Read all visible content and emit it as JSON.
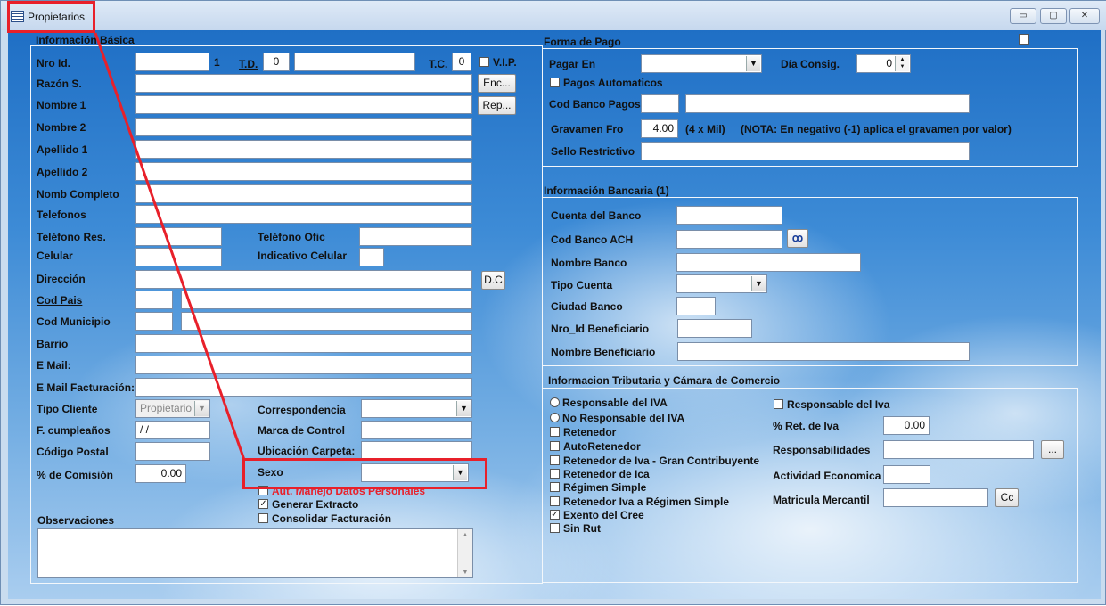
{
  "window": {
    "title": "Propietarios",
    "minimize": "▭",
    "maximize": "▢",
    "close": "✕"
  },
  "basic": {
    "section": "Información Básica",
    "nro_id_label": "Nro Id.",
    "nro_id_value": "",
    "id_suffix": "1",
    "td_label": "T.D.",
    "td_value": "0",
    "tc_label": "T.C.",
    "tc_value": "0",
    "vip_label": "V.I.P.",
    "razon_label": "Razón S.",
    "nombre1_label": "Nombre 1",
    "nombre2_label": "Nombre 2",
    "apellido1_label": "Apellido 1",
    "apellido2_label": "Apellido 2",
    "nomb_completo_label": "Nomb Completo",
    "telefonos_label": "Telefonos",
    "telefono_res_label": "Teléfono Res.",
    "telefono_ofic_label": "Teléfono Ofic",
    "celular_label": "Celular",
    "indicativo_label": "Indicativo Celular",
    "direccion_label": "Dirección",
    "cod_pais_label": "Cod Pais",
    "cod_municipio_label": "Cod Municipio",
    "barrio_label": "Barrio",
    "email_label": "E Mail:",
    "email_fact_label": "E Mail Facturación:",
    "tipo_cliente_label": "Tipo Cliente",
    "tipo_cliente_value": "Propietario",
    "cumple_label": "F. cumpleaños",
    "cumple_value": "/ /",
    "postal_label": "Código Postal",
    "comision_label": "% de Comisión",
    "comision_value": "0.00",
    "correspondencia_label": "Correspondencia",
    "marca_label": "Marca de Control",
    "ubicacion_label": "Ubicación Carpeta:",
    "sexo_label": "Sexo",
    "aut_label": "Aut. Manejo Datos Personales",
    "generar_label": "Generar Extracto",
    "consolidar_label": "Consolidar Facturación",
    "observaciones_label": "Observaciones",
    "enc_button": "Enc...",
    "rep_button": "Rep...",
    "dc_button": "D.C"
  },
  "pago": {
    "section": "Forma de Pago",
    "pagar_en_label": "Pagar En",
    "dia_label": "Día Consig.",
    "dia_value": "0",
    "automaticos_label": "Pagos Automaticos",
    "cod_banco_label": "Cod Banco Pagos",
    "gravamen_label": "Gravamen Fro",
    "gravamen_value": "4.00",
    "gravamen_unit": "(4 x Mil)",
    "gravamen_nota": "(NOTA: En negativo (-1) aplica el gravamen por valor)",
    "sello_label": "Sello Restrictivo"
  },
  "banco": {
    "section": "Información Bancaria (1)",
    "cuenta_label": "Cuenta del Banco",
    "ach_label": "Cod Banco ACH",
    "nombre_label": "Nombre Banco",
    "tipo_label": "Tipo Cuenta",
    "ciudad_label": "Ciudad Banco",
    "nro_benef_label": "Nro_Id Beneficiario",
    "nombre_benef_label": "Nombre Beneficiario"
  },
  "trib": {
    "section": "Informacion Tributaria y Cámara de Comercio",
    "responsable_radio": "Responsable del IVA",
    "no_responsable_radio": "No Responsable del IVA",
    "retenedor": "Retenedor",
    "autoretenedor": "AutoRetenedor",
    "gran_contrib": "Retenedor de Iva - Gran Contribuyente",
    "ret_ica": "Retenedor de Ica",
    "regimen_simple": "Régimen Simple",
    "ret_iva_simple": "Retenedor Iva a Régimen Simple",
    "exento_cree": "Exento del Cree",
    "sin_rut": "Sin Rut",
    "resp_iva_check": "Responsable del Iva",
    "ret_iva_label": "% Ret. de Iva",
    "ret_iva_value": "0.00",
    "responsabilidades_label": "Responsabilidades",
    "actividad_label": "Actividad Economica",
    "matricula_label": "Matricula Mercantil",
    "dots_button": "...",
    "cc_button": "Cc"
  },
  "accent": "#e8202a"
}
